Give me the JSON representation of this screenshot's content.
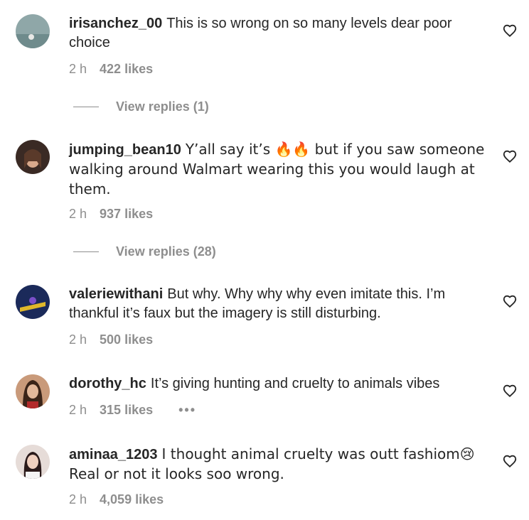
{
  "comments": [
    {
      "username": "irisanchez_00",
      "text": "This is so wrong on so many levels dear poor choice",
      "time": "2 h",
      "likes": "422 likes",
      "replies": "View replies (1)"
    },
    {
      "username": "jumping_bean10",
      "text": "Y’all say it’s 🔥🔥 but if you saw someone walking around Walmart wearing this you would laugh at them.",
      "time": "2 h",
      "likes": "937 likes",
      "replies": "View replies (28)"
    },
    {
      "username": "valeriewithani",
      "text": "But why. Why why why even imitate this. I’m thankful it’s faux but the imagery is still disturbing.",
      "time": "2 h",
      "likes": "500 likes"
    },
    {
      "username": "dorothy_hc",
      "text": "It’s giving hunting and cruelty to animals vibes",
      "time": "2 h",
      "likes": "315 likes",
      "more": "•••"
    },
    {
      "username": "aminaa_1203",
      "text": "I thought animal cruelty was outt fashiom😢 Real or not it looks soo wrong.",
      "time": "2 h",
      "likes": "4,059 likes"
    }
  ],
  "icons": {
    "like": "heart-outline-icon",
    "more": "more-options-icon"
  }
}
